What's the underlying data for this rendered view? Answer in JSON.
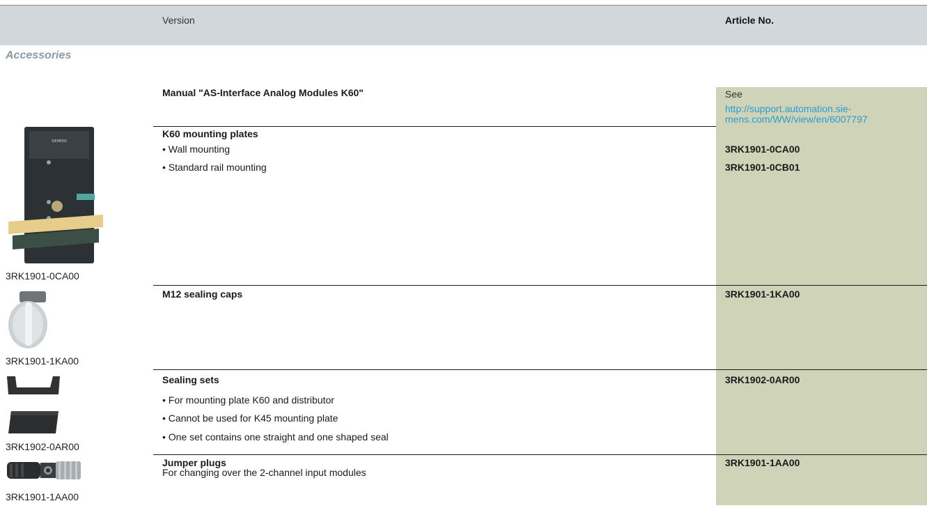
{
  "header": {
    "version": "Version",
    "article_no": "Article No."
  },
  "section_title": "Accessories",
  "rows": [
    {
      "title": "Manual \"AS-Interface Analog Modules K60\"",
      "article_see": "See",
      "article_link_line1": "http://support.automation.sie-",
      "article_link_line2": "mens.com/WW/view/en/6007797"
    },
    {
      "title": "K60 mounting plates",
      "items": [
        "• Wall mounting",
        "• Standard rail mounting"
      ],
      "articles": [
        "3RK1901-0CA00",
        "3RK1901-0CB01"
      ],
      "caption": "3RK1901-0CA00",
      "image_logo_text": "SIEMENS"
    },
    {
      "title": "M12 sealing caps",
      "article": "3RK1901-1KA00",
      "caption": "3RK1901-1KA00"
    },
    {
      "title": "Sealing sets",
      "article": "3RK1902-0AR00",
      "items": [
        "• For mounting plate K60 and distributor",
        "• Cannot be used for K45 mounting plate",
        "• One set contains one straight and one shaped seal"
      ],
      "caption": "3RK1902-0AR00"
    },
    {
      "title": "Jumper plugs",
      "description": "For changing over the 2-channel input modules",
      "article": "3RK1901-1AA00",
      "caption": "3RK1901-1AA00"
    }
  ],
  "colors": {
    "header_band": "#d2d7dc",
    "article_column": "#cfd4b8",
    "section_title": "#8c9aa6",
    "link": "#2a9bd1"
  }
}
